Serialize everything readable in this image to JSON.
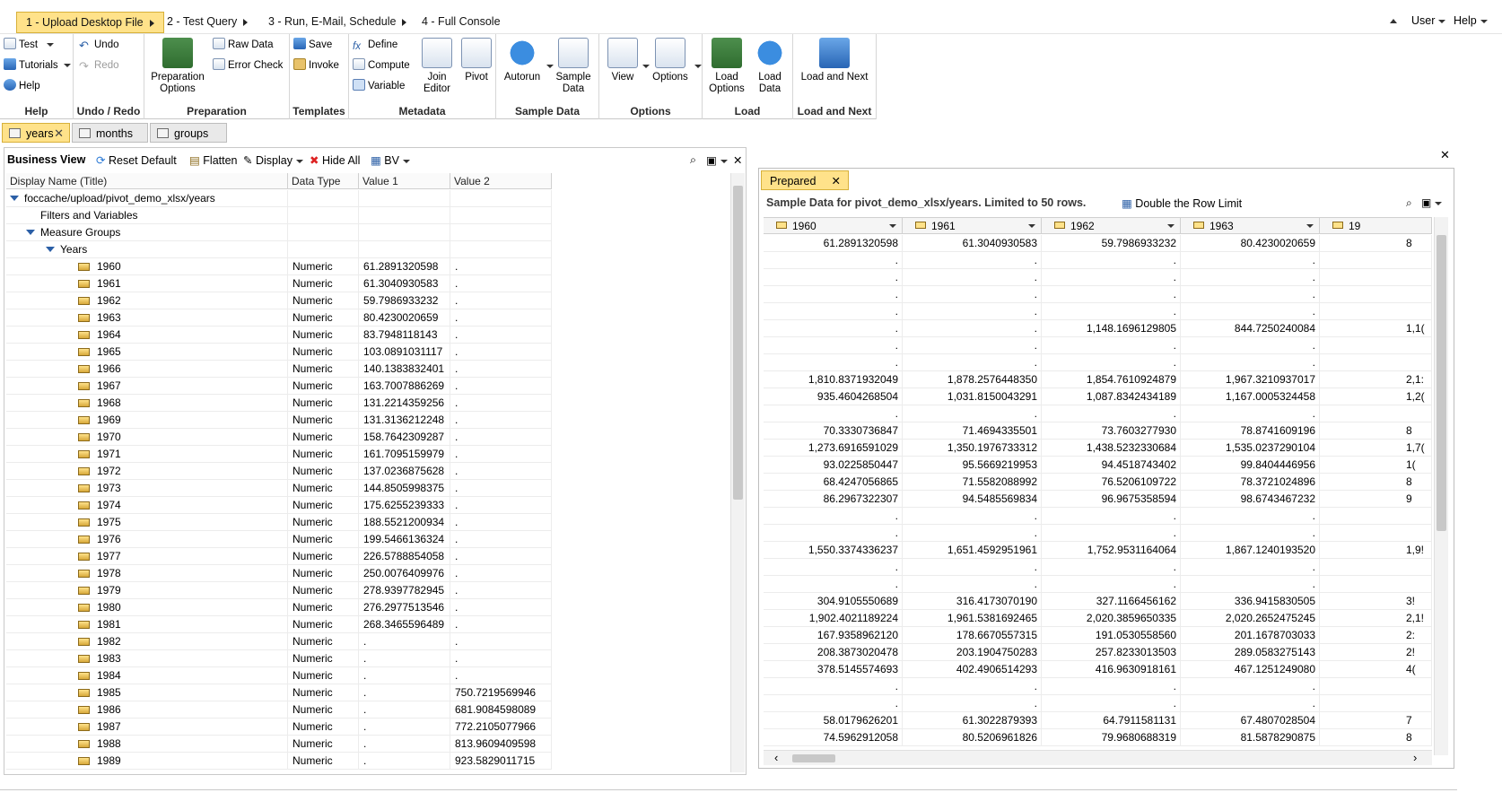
{
  "wizard": {
    "steps": [
      "1 - Upload Desktop File",
      "2 - Test Query",
      "3 - Run, E-Mail, Schedule",
      "4 - Full Console"
    ],
    "user_label": "User",
    "help_label": "Help"
  },
  "ribbon": {
    "help_group": {
      "title": "Help",
      "test": "Test",
      "tutorials": "Tutorials",
      "help": "Help"
    },
    "undo_group": {
      "title": "Undo / Redo",
      "undo": "Undo",
      "redo": "Redo"
    },
    "prep_group": {
      "title": "Preparation",
      "options": "Preparation Options",
      "raw_data": "Raw Data",
      "error_check": "Error Check"
    },
    "templates_group": {
      "title": "Templates",
      "save": "Save",
      "invoke": "Invoke"
    },
    "metadata_group": {
      "title": "Metadata",
      "define": "Define",
      "compute": "Compute",
      "variable": "Variable",
      "join_editor": "Join Editor",
      "pivot": "Pivot"
    },
    "sample_group": {
      "title": "Sample Data",
      "autorun": "Autorun",
      "sample_data": "Sample Data"
    },
    "options_group": {
      "title": "Options",
      "view": "View",
      "options": "Options"
    },
    "load_group": {
      "title": "Load",
      "load_options": "Load Options",
      "load_data": "Load Data"
    },
    "load_next_group": {
      "title": "Load and Next",
      "load_next": "Load and Next"
    }
  },
  "file_tabs": [
    "years",
    "months",
    "groups"
  ],
  "business_view": {
    "title": "Business View",
    "reset_default": "Reset Default",
    "flatten": "Flatten",
    "display": "Display",
    "hide_all": "Hide All",
    "bv": "BV",
    "columns": [
      "Display Name (Title)",
      "Data Type",
      "Value 1",
      "Value 2"
    ],
    "root": "foccache/upload/pivot_demo_xlsx/years",
    "filters": "Filters and Variables",
    "measure_groups": "Measure Groups",
    "group": "Years",
    "rows": [
      {
        "name": "1960",
        "type": "Numeric",
        "v1": "61.2891320598",
        "v2": "."
      },
      {
        "name": "1961",
        "type": "Numeric",
        "v1": "61.3040930583",
        "v2": "."
      },
      {
        "name": "1962",
        "type": "Numeric",
        "v1": "59.7986933232",
        "v2": "."
      },
      {
        "name": "1963",
        "type": "Numeric",
        "v1": "80.4230020659",
        "v2": "."
      },
      {
        "name": "1964",
        "type": "Numeric",
        "v1": "83.7948118143",
        "v2": "."
      },
      {
        "name": "1965",
        "type": "Numeric",
        "v1": "103.0891031117",
        "v2": "."
      },
      {
        "name": "1966",
        "type": "Numeric",
        "v1": "140.1383832401",
        "v2": "."
      },
      {
        "name": "1967",
        "type": "Numeric",
        "v1": "163.7007886269",
        "v2": "."
      },
      {
        "name": "1968",
        "type": "Numeric",
        "v1": "131.2214359256",
        "v2": "."
      },
      {
        "name": "1969",
        "type": "Numeric",
        "v1": "131.3136212248",
        "v2": "."
      },
      {
        "name": "1970",
        "type": "Numeric",
        "v1": "158.7642309287",
        "v2": "."
      },
      {
        "name": "1971",
        "type": "Numeric",
        "v1": "161.7095159979",
        "v2": "."
      },
      {
        "name": "1972",
        "type": "Numeric",
        "v1": "137.0236875628",
        "v2": "."
      },
      {
        "name": "1973",
        "type": "Numeric",
        "v1": "144.8505998375",
        "v2": "."
      },
      {
        "name": "1974",
        "type": "Numeric",
        "v1": "175.6255239333",
        "v2": "."
      },
      {
        "name": "1975",
        "type": "Numeric",
        "v1": "188.5521200934",
        "v2": "."
      },
      {
        "name": "1976",
        "type": "Numeric",
        "v1": "199.5466136324",
        "v2": "."
      },
      {
        "name": "1977",
        "type": "Numeric",
        "v1": "226.5788854058",
        "v2": "."
      },
      {
        "name": "1978",
        "type": "Numeric",
        "v1": "250.0076409976",
        "v2": "."
      },
      {
        "name": "1979",
        "type": "Numeric",
        "v1": "278.9397782945",
        "v2": "."
      },
      {
        "name": "1980",
        "type": "Numeric",
        "v1": "276.2977513546",
        "v2": "."
      },
      {
        "name": "1981",
        "type": "Numeric",
        "v1": "268.3465596489",
        "v2": "."
      },
      {
        "name": "1982",
        "type": "Numeric",
        "v1": ".",
        "v2": "."
      },
      {
        "name": "1983",
        "type": "Numeric",
        "v1": ".",
        "v2": "."
      },
      {
        "name": "1984",
        "type": "Numeric",
        "v1": ".",
        "v2": "."
      },
      {
        "name": "1985",
        "type": "Numeric",
        "v1": ".",
        "v2": "750.7219569946"
      },
      {
        "name": "1986",
        "type": "Numeric",
        "v1": ".",
        "v2": "681.9084598089"
      },
      {
        "name": "1987",
        "type": "Numeric",
        "v1": ".",
        "v2": "772.2105077966"
      },
      {
        "name": "1988",
        "type": "Numeric",
        "v1": ".",
        "v2": "813.9609409598"
      },
      {
        "name": "1989",
        "type": "Numeric",
        "v1": ".",
        "v2": "923.5829011715"
      }
    ]
  },
  "sample_panel": {
    "tab": "Prepared",
    "title": "Sample Data for pivot_demo_xlsx/years. Limited to 50 rows.",
    "double_limit": "Double the Row Limit",
    "columns": [
      "1960",
      "1961",
      "1962",
      "1963",
      "19"
    ],
    "rows": [
      [
        "61.2891320598",
        "61.3040930583",
        "59.7986933232",
        "80.4230020659",
        "8"
      ],
      [
        ".",
        ".",
        ".",
        ".",
        ""
      ],
      [
        ".",
        ".",
        ".",
        ".",
        ""
      ],
      [
        ".",
        ".",
        ".",
        ".",
        ""
      ],
      [
        ".",
        ".",
        ".",
        ".",
        ""
      ],
      [
        ".",
        ".",
        "1,148.1696129805",
        "844.7250240084",
        "1,1("
      ],
      [
        ".",
        ".",
        ".",
        ".",
        ""
      ],
      [
        ".",
        ".",
        ".",
        ".",
        ""
      ],
      [
        "1,810.8371932049",
        "1,878.2576448350",
        "1,854.7610924879",
        "1,967.3210937017",
        "2,1:"
      ],
      [
        "935.4604268504",
        "1,031.8150043291",
        "1,087.8342434189",
        "1,167.0005324458",
        "1,2("
      ],
      [
        ".",
        ".",
        ".",
        ".",
        ""
      ],
      [
        "70.3330736847",
        "71.4694335501",
        "73.7603277930",
        "78.8741609196",
        "8"
      ],
      [
        "1,273.6916591029",
        "1,350.1976733312",
        "1,438.5232330684",
        "1,535.0237290104",
        "1,7("
      ],
      [
        "93.0225850447",
        "95.5669219953",
        "94.4518743402",
        "99.8404446956",
        "1("
      ],
      [
        "68.4247056865",
        "71.5582088992",
        "76.5206109722",
        "78.3721024896",
        "8"
      ],
      [
        "86.2967322307",
        "94.5485569834",
        "96.9675358594",
        "98.6743467232",
        "9"
      ],
      [
        ".",
        ".",
        ".",
        ".",
        ""
      ],
      [
        ".",
        ".",
        ".",
        ".",
        ""
      ],
      [
        "1,550.3374336237",
        "1,651.4592951961",
        "1,752.9531164064",
        "1,867.1240193520",
        "1,9!"
      ],
      [
        ".",
        ".",
        ".",
        ".",
        ""
      ],
      [
        ".",
        ".",
        ".",
        ".",
        ""
      ],
      [
        "304.9105550689",
        "316.4173070190",
        "327.1166456162",
        "336.9415830505",
        "3!"
      ],
      [
        "1,902.4021189224",
        "1,961.5381692465",
        "2,020.3859650335",
        "2,020.2652475245",
        "2,1!"
      ],
      [
        "167.9358962120",
        "178.6670557315",
        "191.0530558560",
        "201.1678703033",
        "2:"
      ],
      [
        "208.3873020478",
        "203.1904750283",
        "257.8233013503",
        "289.0583275143",
        "2!"
      ],
      [
        "378.5145574693",
        "402.4906514293",
        "416.9630918161",
        "467.1251249080",
        "4("
      ],
      [
        ".",
        ".",
        ".",
        ".",
        ""
      ],
      [
        ".",
        ".",
        ".",
        ".",
        ""
      ],
      [
        "58.0179626201",
        "61.3022879393",
        "64.7911581131",
        "67.4807028504",
        "7"
      ],
      [
        "74.5962912058",
        "80.5206961826",
        "79.9680688319",
        "81.5878290875",
        "8"
      ]
    ]
  }
}
